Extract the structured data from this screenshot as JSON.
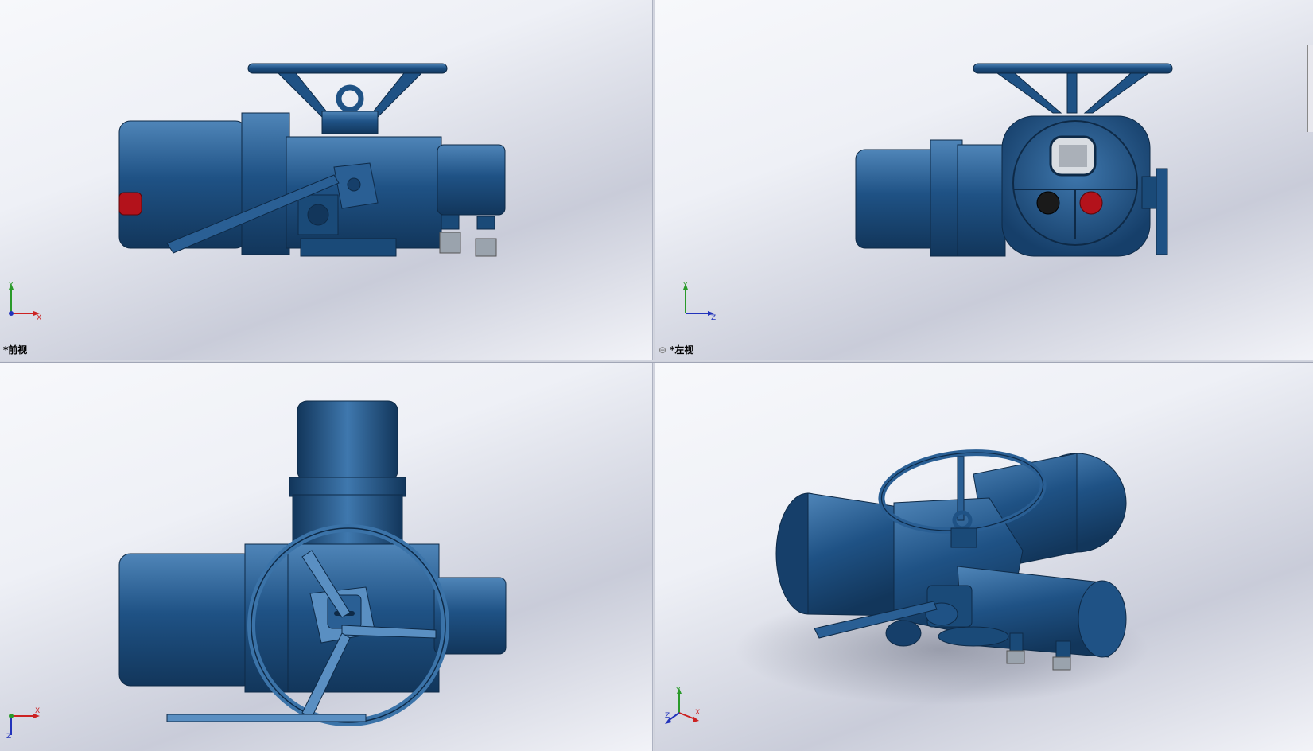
{
  "viewports": [
    {
      "id": "front",
      "label": "*前视",
      "axes": [
        "Y",
        "X"
      ],
      "linked": false
    },
    {
      "id": "left",
      "label": "*左视",
      "axes": [
        "Y",
        "Z"
      ],
      "linked": true
    },
    {
      "id": "top",
      "label": "",
      "axes": [
        "X",
        "Z"
      ],
      "linked": false
    },
    {
      "id": "iso",
      "label": "",
      "axes": [
        "Y",
        "Z",
        "X"
      ],
      "linked": false
    }
  ],
  "colors": {
    "body": "#1f5285",
    "body_dark": "#13375d",
    "body_light": "#4f85b8",
    "red_knob": "#b3121b",
    "black_knob": "#1a1a1a",
    "axis_x": "#cc2222",
    "axis_y": "#2a9a2a",
    "axis_z": "#2233bb"
  },
  "icons": {
    "link": "link-icon",
    "triad": "coordinate-triad-icon"
  }
}
